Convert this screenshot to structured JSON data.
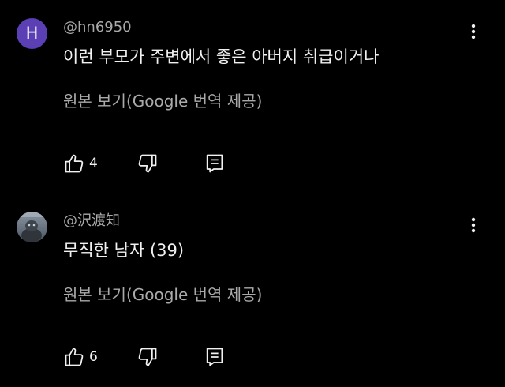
{
  "comments": [
    {
      "avatar_letter": "H",
      "avatar_color": "#5b3fb5",
      "username": "@hn6950",
      "text": "이런 부모가 주변에서 좋은 아버지 취급이거나",
      "translate_label": "원본 보기(Google 번역 제공)",
      "like_count": "4",
      "more_icon": "more-vertical-icon"
    },
    {
      "avatar_letter": "",
      "avatar_kind": "photo",
      "username": "@沢渡知",
      "text": "무직한 남자 (39)",
      "translate_label": "원본 보기(Google 번역 제공)",
      "like_count": "6",
      "more_icon": "more-vertical-icon"
    }
  ],
  "icons": {
    "like": "thumbs-up-icon",
    "dislike": "thumbs-down-icon",
    "reply": "reply-icon"
  },
  "colors": {
    "background": "#000000",
    "primary_text": "#f1f1f1",
    "secondary_text": "#aaaaaa"
  }
}
